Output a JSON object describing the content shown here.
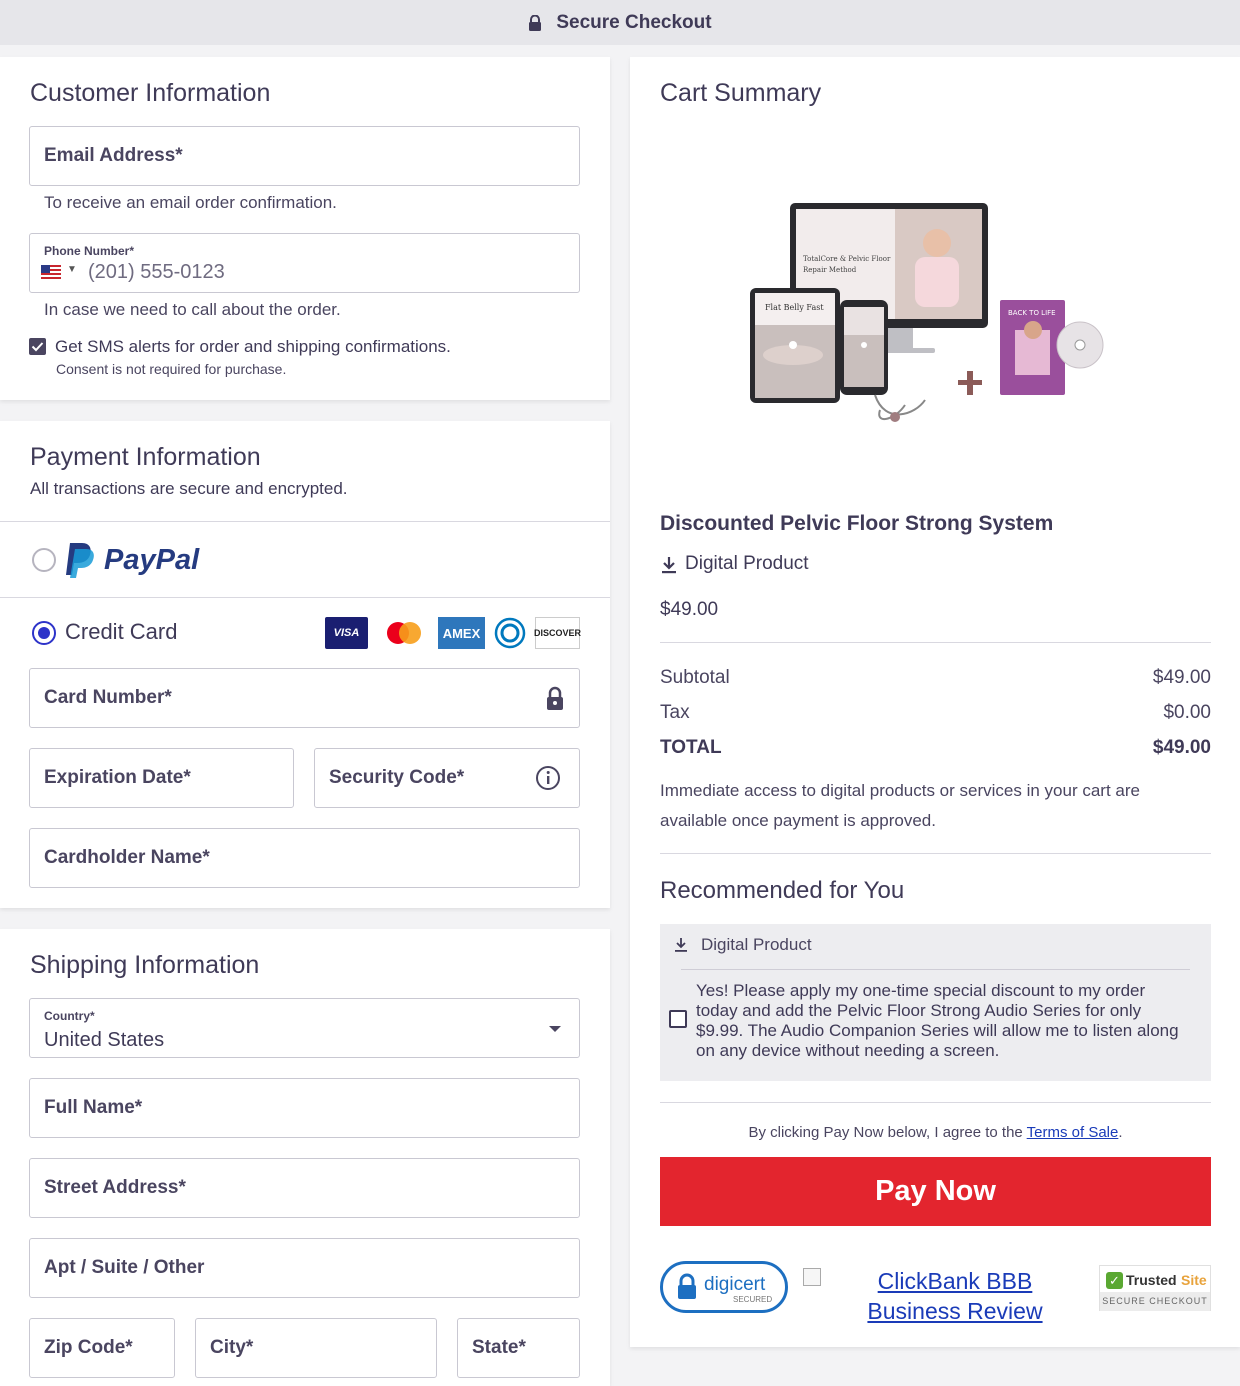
{
  "header": {
    "title": "Secure Checkout"
  },
  "customer": {
    "heading": "Customer Information",
    "email_label": "Email Address*",
    "email_hint": "To receive an email order confirmation.",
    "phone_label": "Phone Number*",
    "phone_placeholder": "(201) 555-0123",
    "phone_hint": "In case we need to call about the order.",
    "sms_label": "Get SMS alerts for order and shipping confirmations.",
    "sms_note": "Consent is not required for purchase.",
    "sms_checked": true
  },
  "payment": {
    "heading": "Payment Information",
    "subheading": "All transactions are secure and encrypted.",
    "paypal_label": "PayPal",
    "credit_label": "Credit Card",
    "card_logos": [
      "VISA",
      "mastercard",
      "AMEX",
      "diners",
      "DISCOVER"
    ],
    "card_number_label": "Card Number*",
    "expiration_label": "Expiration Date*",
    "security_label": "Security Code*",
    "cardholder_label": "Cardholder Name*",
    "selected_method": "Credit Card"
  },
  "shipping": {
    "heading": "Shipping Information",
    "country_label": "Country*",
    "country_value": "United States",
    "full_name_label": "Full Name*",
    "street_label": "Street Address*",
    "apt_label": "Apt / Suite / Other",
    "zip_label": "Zip Code*",
    "city_label": "City*",
    "state_label": "State*"
  },
  "cart": {
    "heading": "Cart Summary",
    "product_name": "Discounted Pelvic Floor Strong System",
    "product_type": "Digital Product",
    "product_price": "$49.00",
    "image_texts": {
      "monitor_line1": "TotalCore & Pelvic Floor",
      "monitor_line2": "Repair Method",
      "tablet_title": "Flat Belly Fast",
      "book_title": "BACK TO LIFE"
    },
    "subtotal_label": "Subtotal",
    "subtotal_value": "$49.00",
    "tax_label": "Tax",
    "tax_value": "$0.00",
    "total_label": "TOTAL",
    "total_value": "$49.00",
    "access_note": "Immediate access to digital products or services in your cart are available once payment is approved."
  },
  "recommend": {
    "heading": "Recommended for You",
    "type_label": "Digital Product",
    "offer_text": "Yes! Please apply my one-time special discount to my order today and add the Pelvic Floor Strong Audio Series for only $9.99. The Audio Companion Series will allow me to listen along on any device without needing a screen.",
    "checked": false
  },
  "checkout": {
    "terms_prefix": "By clicking Pay Now below, I agree to the ",
    "terms_link": "Terms of Sale",
    "terms_suffix": ".",
    "pay_button": "Pay Now"
  },
  "badges": {
    "digicert": "digicert",
    "digicert_sub": "SECURED",
    "bbb_link": "ClickBank BBB Business Review",
    "trusted_a": "Trusted",
    "trusted_b": "Site",
    "trusted_sub": "SECURE CHECKOUT"
  },
  "colors": {
    "accent": "#2d33c9",
    "pay_button": "#e3252e",
    "text": "#3f3a57",
    "link": "#1a3bb8"
  },
  "icons": {
    "lock": "lock-icon",
    "info": "info-icon",
    "download": "download-icon",
    "caret": "caret-down-icon",
    "flag": "us-flag-icon"
  }
}
